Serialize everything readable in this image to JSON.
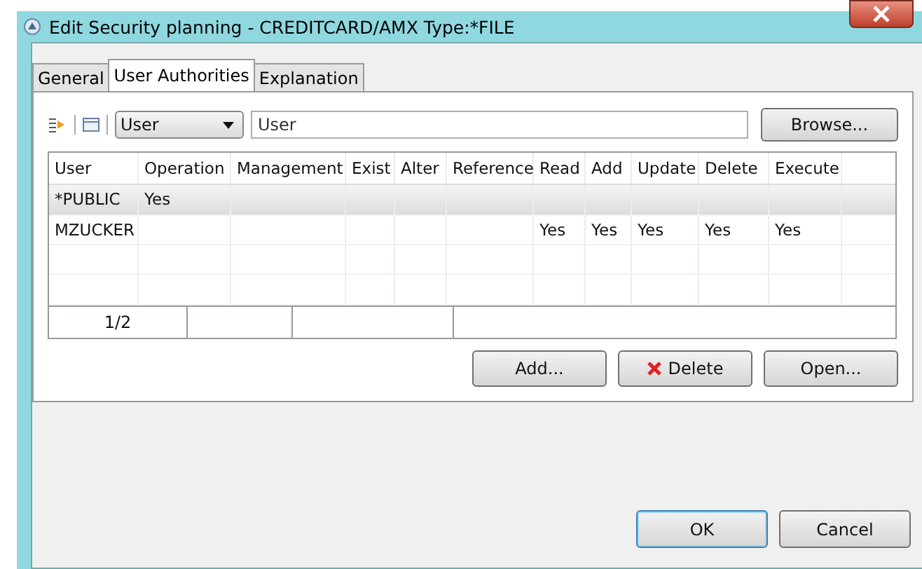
{
  "window": {
    "title": "Edit Security planning - CREDITCARD/AMX Type:*FILE"
  },
  "tabs": [
    {
      "label": "General",
      "selected": false
    },
    {
      "label": "User Authorities",
      "selected": true
    },
    {
      "label": "Explanation",
      "selected": false
    }
  ],
  "filter": {
    "dropdown": "User",
    "value": "User",
    "browse_button": "Browse..."
  },
  "table": {
    "columns": [
      "User",
      "Operation",
      "Management",
      "Exist",
      "Alter",
      "Reference",
      "Read",
      "Add",
      "Update",
      "Delete",
      "Execute"
    ],
    "rows": [
      {
        "selected": true,
        "cells": [
          "*PUBLIC",
          "Yes",
          "",
          "",
          "",
          "",
          "",
          "",
          "",
          "",
          ""
        ]
      },
      {
        "selected": false,
        "cells": [
          "MZUCKER",
          "",
          "",
          "",
          "",
          "",
          "Yes",
          "Yes",
          "Yes",
          "Yes",
          "Yes"
        ]
      }
    ],
    "footer": "1/2"
  },
  "buttons": [
    "Add...",
    "Delete",
    "Open..."
  ],
  "dialog_buttons": [
    "OK",
    "Cancel"
  ]
}
